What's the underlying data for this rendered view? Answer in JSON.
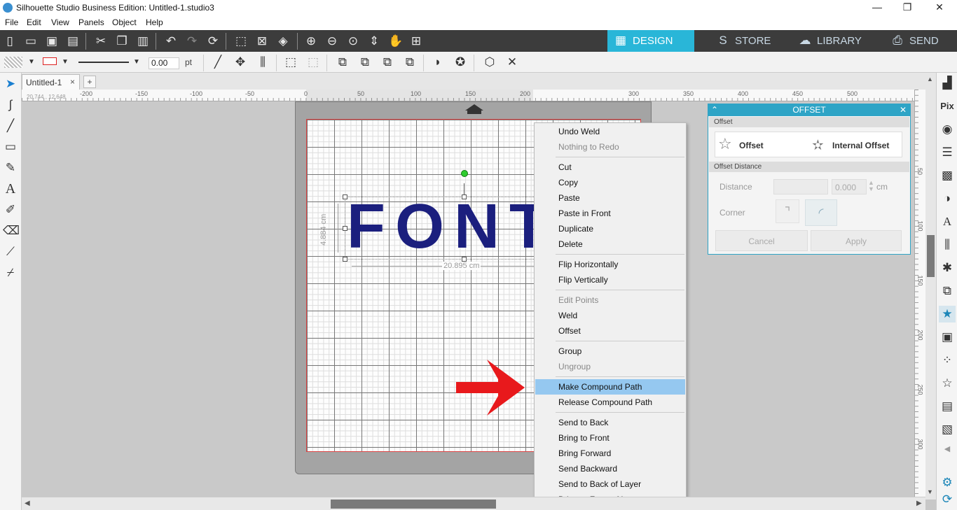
{
  "window": {
    "title": "Silhouette Studio Business Edition: Untitled-1.studio3",
    "minimize": "—",
    "maximize": "❐",
    "close": "✕"
  },
  "menubar": [
    "File",
    "Edit",
    "View",
    "Panels",
    "Object",
    "Help"
  ],
  "nav_tabs": {
    "design": "DESIGN",
    "store": "STORE",
    "library": "LIBRARY",
    "send": "SEND"
  },
  "toolbar2": {
    "line_width": "0.00",
    "unit": "pt"
  },
  "document": {
    "tab_label": "Untitled-1",
    "tab_close": "×",
    "add_tab": "+",
    "coords": "20.744 , 12.648"
  },
  "ruler": {
    "h_labels": [
      "-200",
      "-150",
      "-100",
      "-50",
      "0",
      "50",
      "100",
      "150",
      "200",
      "300",
      "350",
      "400",
      "450",
      "500"
    ],
    "v_labels": [
      "50",
      "100",
      "150",
      "200",
      "250",
      "300"
    ]
  },
  "canvas": {
    "text": "FONT",
    "height_dim": "4.884 cm",
    "width_dim": "20.895 cm"
  },
  "context_menu": {
    "items": [
      {
        "label": "Undo Weld",
        "state": "normal"
      },
      {
        "label": "Nothing to Redo",
        "state": "disabled"
      },
      {
        "label": "Cut",
        "state": "normal"
      },
      {
        "label": "Copy",
        "state": "normal"
      },
      {
        "label": "Paste",
        "state": "normal"
      },
      {
        "label": "Paste in Front",
        "state": "normal"
      },
      {
        "label": "Duplicate",
        "state": "normal"
      },
      {
        "label": "Delete",
        "state": "normal"
      },
      {
        "label": "Flip Horizontally",
        "state": "normal"
      },
      {
        "label": "Flip Vertically",
        "state": "normal"
      },
      {
        "label": "Edit Points",
        "state": "disabled"
      },
      {
        "label": "Weld",
        "state": "normal"
      },
      {
        "label": "Offset",
        "state": "normal"
      },
      {
        "label": "Group",
        "state": "normal"
      },
      {
        "label": "Ungroup",
        "state": "disabled"
      },
      {
        "label": "Make Compound Path",
        "state": "highlighted"
      },
      {
        "label": "Release Compound Path",
        "state": "normal"
      },
      {
        "label": "Send to Back",
        "state": "normal"
      },
      {
        "label": "Bring to Front",
        "state": "normal"
      },
      {
        "label": "Bring Forward",
        "state": "normal"
      },
      {
        "label": "Send Backward",
        "state": "normal"
      },
      {
        "label": "Send to Back of Layer",
        "state": "normal"
      },
      {
        "label": "Bring to Front of Layer",
        "state": "normal"
      }
    ]
  },
  "offset_panel": {
    "title": "OFFSET",
    "section_offset": "Offset",
    "offset_btn": "Offset",
    "internal_offset_btn": "Internal Offset",
    "section_distance": "Offset Distance",
    "distance_label": "Distance",
    "distance_value": "0.000",
    "distance_unit": "cm",
    "corner_label": "Corner",
    "cancel": "Cancel",
    "apply": "Apply"
  },
  "colors": {
    "accent": "#29b6d8",
    "text_fill": "#1b1f7e",
    "menu_highlight": "#95c8f0",
    "annotation_arrow": "#e8191c"
  }
}
